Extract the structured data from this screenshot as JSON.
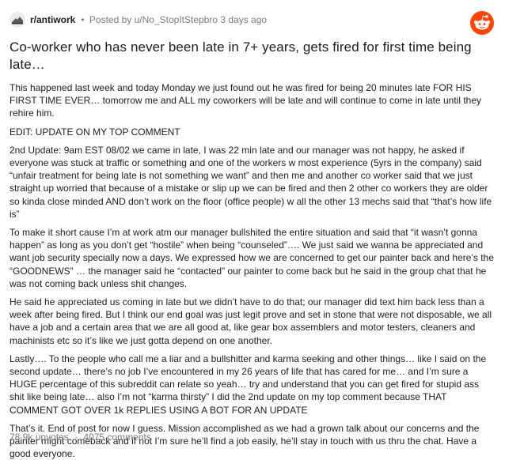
{
  "header": {
    "subreddit": "r/antiwork",
    "separator": "•",
    "posted_by": "Posted by u/No_StopItStepbro 3 days ago"
  },
  "post": {
    "title": "Co-worker who has never been late in 7+ years, gets fired for first time being late…",
    "paragraphs": [
      "This happened last week and today Monday we just found out he was fired for being 20 minutes late FOR HIS FIRST TIME EVER… tomorrow me and ALL my coworkers will be late and will continue to come in late until they rehire him.",
      "EDIT: UPDATE ON MY TOP COMMENT",
      "2nd Update: 9am EST 08/02 we came in late, I was 22 min late and our manager was not happy, he asked if everyone was stuck at traffic or something and one of the workers w most experience (5yrs in the company) said “unfair treatment for being late is not something we want” and then me and another co worker said that we just straight up worried that because of a mistake or slip up we can be fired and then 2 other co workers they are older so kinda close minded AND don’t work on the floor (office people) w all the other 13 mechs said that “that’s how life is”",
      "To make it short cause I’m at work atm our manager bullshited the entire situation and said that “it wasn’t gonna happen” as long as you don’t get “hostile” when being “counseled”…. We just said we wanna be appreciated and want job security specially now a days. We expressed how we are concerned to get our painter back and here’s the “GOODNEWS” … the manager said he “contacted” our painter to come back but he said in the group chat that he was not coming back unless shit changes.",
      "He said he appreciated us coming in late but we didn’t have to do that; our manager did text him back less than a week after being fired. But I think our end goal was just legit prove and set in stone that were not disposable, we all have a job and a certain area that we are all good at, like gear box assemblers and motor testers, cleaners and machinists etc so it’s like we just gotta depend on one another.",
      "Lastly…. To the people who call me a liar and a bullshitter and karma seeking and other things… like I said on the second update… there’s no job I’ve encountered in my 26 years of life that has cared for me… and I’m sure a HUGE percentage of this subreddit can relate so yeah… try and understand that you can get fired for stupid ass shit like being late… also I’m not “karma thirsty” I did the 2nd update on my top comment because THAT COMMENT GOT OVER 1k REPLIES USING A BOT FOR AN UPDATE",
      "That’s it. End of post for now I guess. Mission accomplished as we had a grown talk about our concerns and the painter might comeback and if not I’m sure he’ll find a job easily, he’ll stay in touch with us thru the chat. Have a good everyone."
    ]
  },
  "footer": {
    "upvotes": "78.9k upvotes",
    "separator": "·",
    "comments": "4075 comments"
  },
  "icons": {
    "subreddit_icon": "antiwork-subreddit-icon",
    "reddit_logo": "reddit-snoo-icon"
  },
  "colors": {
    "text": "#1c1c1c",
    "meta": "#787c7e",
    "reddit_orange": "#ff4500"
  }
}
